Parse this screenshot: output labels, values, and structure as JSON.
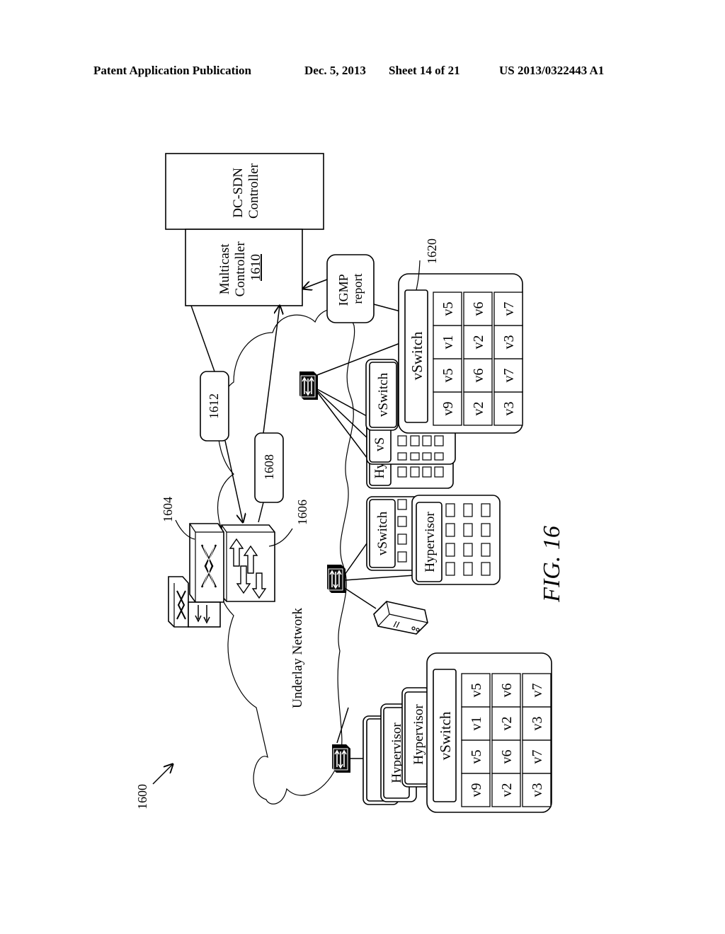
{
  "header": {
    "publication": "Patent Application Publication",
    "date": "Dec. 5, 2013",
    "sheet": "Sheet 14 of 21",
    "number": "US 2013/0322443 A1"
  },
  "figure": {
    "caption": "FIG. 16",
    "ref_overall": "1600",
    "cloud_label": "Underlay Network",
    "dc_sdn_controller": [
      "DC-SDN",
      "Controller"
    ],
    "multicast_controller": [
      "Multicast",
      "Controller"
    ],
    "multicast_controller_ref": "1610",
    "igmp_report": [
      "IGMP",
      "report"
    ],
    "ref_1612": "1612",
    "ref_1608": "1608",
    "ref_1604": "1604",
    "ref_1606": "1606",
    "ref_1620": "1620",
    "vswitch_label": "vSwitch",
    "hypervisor_label": "Hypervisor",
    "hyp_partial": "Hyp",
    "vs_partial": "vS",
    "vm_grid_right": [
      [
        "v9",
        "v5",
        "v1",
        "v5"
      ],
      [
        "v2",
        "v6",
        "v2",
        "v6"
      ],
      [
        "v3",
        "v7",
        "v3",
        "v7"
      ]
    ],
    "vm_grid_bottom": [
      [
        "v9",
        "v5",
        "v1",
        "v5"
      ],
      [
        "v2",
        "v6",
        "v2",
        "v6"
      ],
      [
        "v3",
        "v7",
        "v3",
        "v7"
      ]
    ]
  },
  "icons": {
    "tor_switch": "tor-switch-icon",
    "core_router": "core-router-icon",
    "storage": "storage-server-icon"
  }
}
